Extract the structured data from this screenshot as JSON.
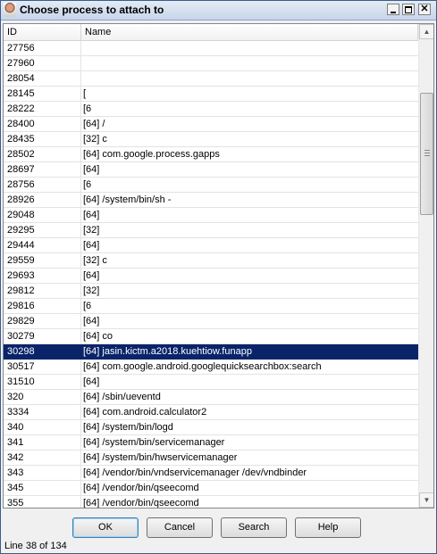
{
  "window": {
    "title": "Choose process to attach to"
  },
  "columns": {
    "id": "ID",
    "name": "Name"
  },
  "rows": [
    {
      "id": "27756",
      "name": "",
      "selected": false
    },
    {
      "id": "27960",
      "name": "",
      "selected": false
    },
    {
      "id": "28054",
      "name": "",
      "selected": false
    },
    {
      "id": "28145",
      "name": "[",
      "selected": false
    },
    {
      "id": "28222",
      "name": "[6",
      "selected": false
    },
    {
      "id": "28400",
      "name": "[64] /",
      "selected": false
    },
    {
      "id": "28435",
      "name": "[32] c",
      "selected": false
    },
    {
      "id": "28502",
      "name": "[64] com.google.process.gapps",
      "selected": false
    },
    {
      "id": "28697",
      "name": "[64]",
      "selected": false
    },
    {
      "id": "28756",
      "name": "[6",
      "selected": false
    },
    {
      "id": "28926",
      "name": "[64] /system/bin/sh -",
      "selected": false
    },
    {
      "id": "29048",
      "name": "[64]",
      "selected": false
    },
    {
      "id": "29295",
      "name": "[32]",
      "selected": false
    },
    {
      "id": "29444",
      "name": "[64]",
      "selected": false
    },
    {
      "id": "29559",
      "name": "[32] c",
      "selected": false
    },
    {
      "id": "29693",
      "name": "[64]",
      "selected": false
    },
    {
      "id": "29812",
      "name": "[32]",
      "selected": false
    },
    {
      "id": "29816",
      "name": "[6",
      "selected": false
    },
    {
      "id": "29829",
      "name": "[64]",
      "selected": false
    },
    {
      "id": "30279",
      "name": "[64] co",
      "selected": false
    },
    {
      "id": "30298",
      "name": "[64] jasin.kictm.a2018.kuehtiow.funapp",
      "selected": true
    },
    {
      "id": "30517",
      "name": "[64] com.google.android.googlequicksearchbox:search",
      "selected": false
    },
    {
      "id": "31510",
      "name": "[64]",
      "selected": false
    },
    {
      "id": "320",
      "name": "[64] /sbin/ueventd",
      "selected": false
    },
    {
      "id": "3334",
      "name": "[64] com.android.calculator2",
      "selected": false
    },
    {
      "id": "340",
      "name": "[64] /system/bin/logd",
      "selected": false
    },
    {
      "id": "341",
      "name": "[64] /system/bin/servicemanager",
      "selected": false
    },
    {
      "id": "342",
      "name": "[64] /system/bin/hwservicemanager",
      "selected": false
    },
    {
      "id": "343",
      "name": "[64] /vendor/bin/vndservicemanager /dev/vndbinder",
      "selected": false
    },
    {
      "id": "345",
      "name": "[64] /vendor/bin/qseecomd",
      "selected": false
    },
    {
      "id": "355",
      "name": "[64] /vendor/bin/qseecomd",
      "selected": false
    }
  ],
  "buttons": {
    "ok": "OK",
    "cancel": "Cancel",
    "search": "Search",
    "help": "Help"
  },
  "status": "Line 38 of 134",
  "colors": {
    "selection": "#0a246a",
    "title_bar": "#c7d5e9"
  },
  "icons": {
    "app": "app-icon",
    "minimize": "minimize-icon",
    "maximize": "maximize-icon",
    "close": "close-icon"
  }
}
